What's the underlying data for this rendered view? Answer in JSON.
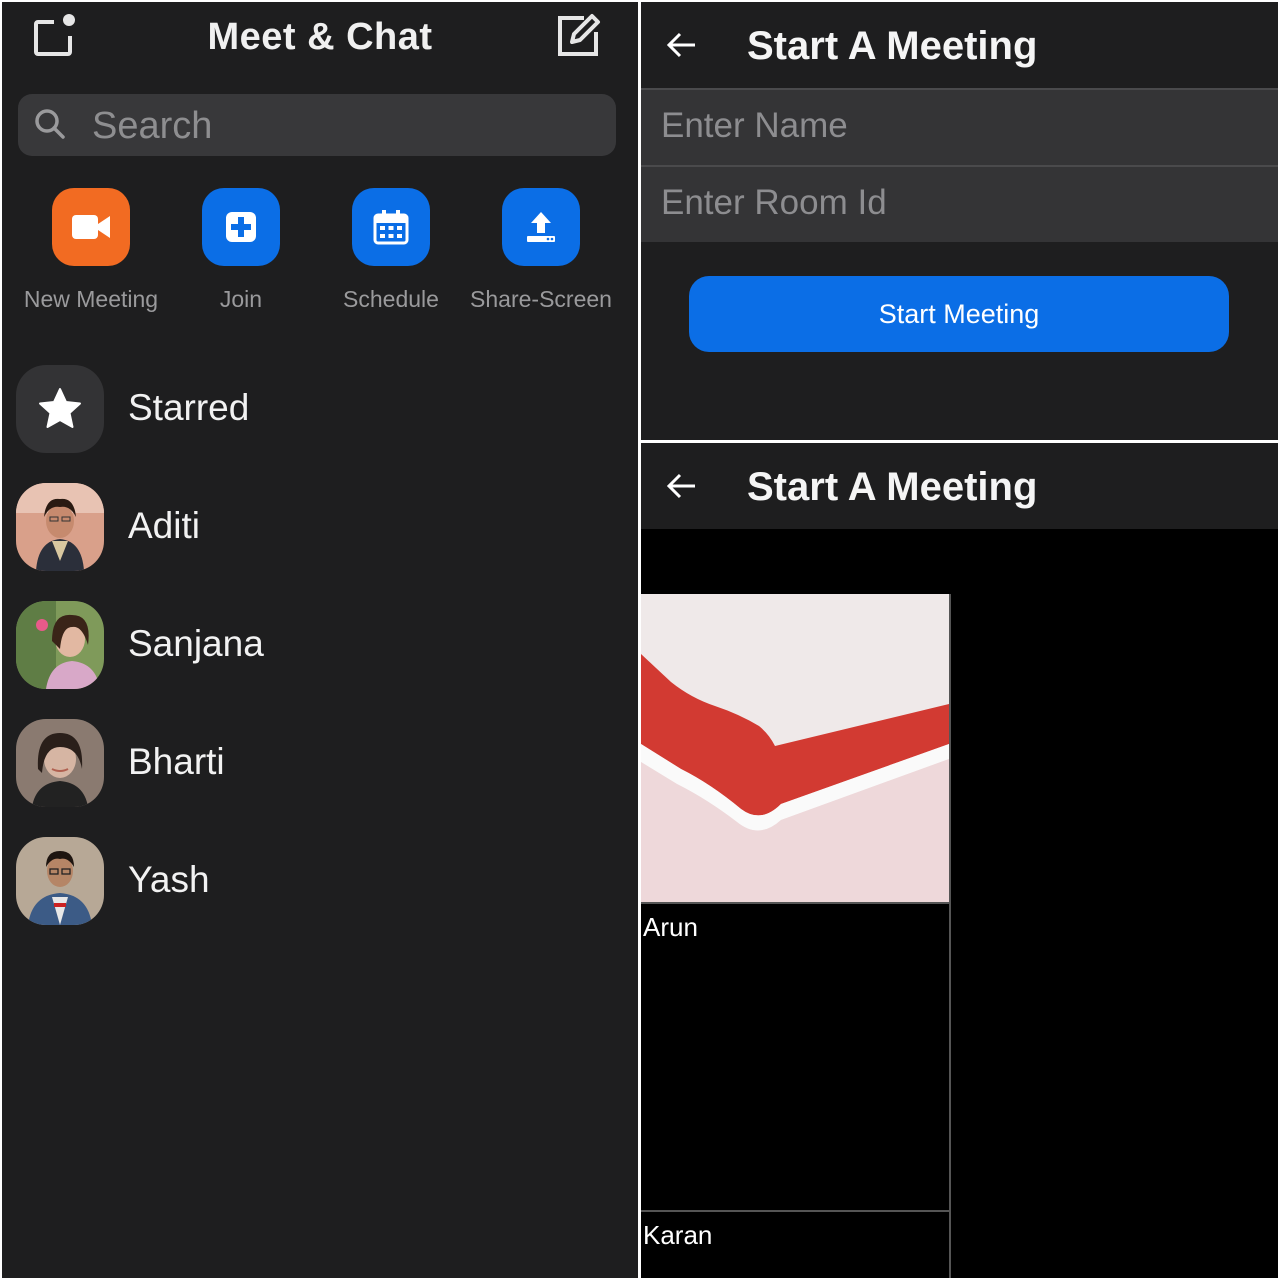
{
  "left": {
    "title": "Meet & Chat",
    "search_placeholder": "Search",
    "actions": [
      {
        "label": "New Meeting",
        "icon": "video-camera-icon",
        "color": "#f26b22"
      },
      {
        "label": "Join",
        "icon": "plus-square-icon",
        "color": "#0b6ee6"
      },
      {
        "label": "Schedule",
        "icon": "calendar-icon",
        "color": "#0b6ee6"
      },
      {
        "label": "Share-Screen",
        "icon": "upload-icon",
        "color": "#0b6ee6"
      }
    ],
    "contacts": [
      {
        "name": "Starred",
        "icon": "star-icon"
      },
      {
        "name": "Aditi"
      },
      {
        "name": "Sanjana"
      },
      {
        "name": "Bharti"
      },
      {
        "name": "Yash"
      }
    ]
  },
  "start_form": {
    "title": "Start A Meeting",
    "name_placeholder": "Enter Name",
    "room_placeholder": "Enter Room Id",
    "button_label": "Start Meeting",
    "accent": "#0b6ee6"
  },
  "meeting_view": {
    "title": "Start A Meeting",
    "participants": [
      {
        "name": "Arun"
      },
      {
        "name": "Karan"
      }
    ]
  }
}
